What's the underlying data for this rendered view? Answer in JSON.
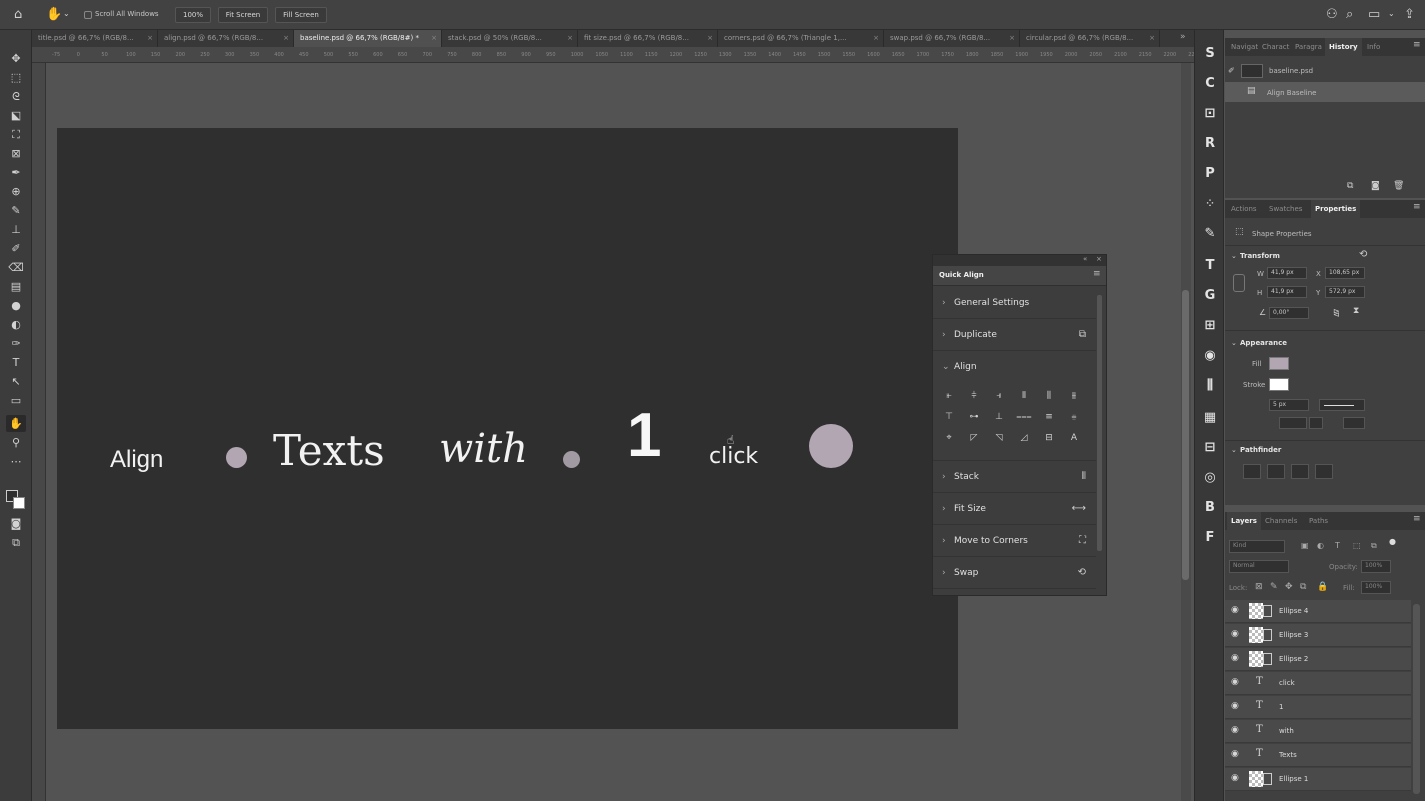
{
  "options_bar": {
    "scroll_all_windows": "Scroll All Windows",
    "zoom": "100%",
    "fit_screen": "Fit Screen",
    "fill_screen": "Fill Screen"
  },
  "tabs": [
    {
      "label": "title.psd @ 66,7% (RGB/8..."
    },
    {
      "label": "align.psd @ 66,7% (RGB/8..."
    },
    {
      "label": "baseline.psd @ 66,7% (RGB/8#) *"
    },
    {
      "label": "stack.psd @ 50% (RGB/8..."
    },
    {
      "label": "fit size.psd @ 66,7% (RGB/8..."
    },
    {
      "label": "corners.psd @ 66,7% (Triangle 1,..."
    },
    {
      "label": "swap.psd @ 66,7% (RGB/8..."
    },
    {
      "label": "circular.psd @ 66,7% (RGB/8..."
    }
  ],
  "ruler_ticks": [
    "-75",
    "0",
    "50",
    "100",
    "150",
    "200",
    "250",
    "300",
    "350",
    "400",
    "450",
    "500",
    "550",
    "600",
    "650",
    "700",
    "750",
    "800",
    "850",
    "900",
    "950",
    "1000",
    "1050",
    "1100",
    "1150",
    "1200",
    "1250",
    "1300",
    "1350",
    "1400",
    "1450",
    "1500",
    "1550",
    "1600",
    "1650",
    "1700",
    "1750",
    "1800",
    "1850",
    "1900",
    "1950",
    "2000",
    "2050",
    "2100",
    "2150",
    "2200",
    "2250",
    "2300"
  ],
  "canvas": {
    "word_align": "Align",
    "word_texts": "Texts",
    "word_with": "with",
    "word_one": "1",
    "word_click": "click"
  },
  "quick_align": {
    "title": "Quick Align",
    "sections": [
      {
        "label": "General Settings"
      },
      {
        "label": "Duplicate"
      },
      {
        "label": "Align"
      },
      {
        "label": "Stack"
      },
      {
        "label": "Fit Size"
      },
      {
        "label": "Move to Corners"
      },
      {
        "label": "Swap"
      }
    ]
  },
  "history_panel": {
    "tabs": [
      "Navigat",
      "Charact",
      "Paragra",
      "History",
      "Info"
    ],
    "active_tab": "History",
    "snapshot": "baseline.psd",
    "step": "Align Baseline"
  },
  "properties_panel": {
    "tabs": [
      "Actions",
      "Swatches",
      "Properties"
    ],
    "active_tab": "Properties",
    "kind": "Shape Properties",
    "transform_label": "Transform",
    "w_label": "W",
    "w": "41,9 px",
    "h_label": "H",
    "h": "41,9 px",
    "x_label": "X",
    "x": "108,65 px",
    "y_label": "Y",
    "y": "572,9 px",
    "angle": "0,00°",
    "appearance_label": "Appearance",
    "fill_label": "Fill",
    "stroke_label": "Stroke",
    "stroke_width": "5 px",
    "pathfinder_label": "Pathfinder",
    "fill_color": "#b3a6b3"
  },
  "layers_panel": {
    "tabs": [
      "Layers",
      "Channels",
      "Paths"
    ],
    "active_tab": "Layers",
    "search_placeholder": "Kind",
    "blend_mode": "Normal",
    "opacity_label": "Opacity:",
    "opacity": "100%",
    "lock_label": "Lock:",
    "fill_label": "Fill:",
    "fill": "100%",
    "layers": [
      {
        "name": "Ellipse 4",
        "type": "shape"
      },
      {
        "name": "Ellipse 3",
        "type": "shape"
      },
      {
        "name": "Ellipse 2",
        "type": "shape"
      },
      {
        "name": "click",
        "type": "text"
      },
      {
        "name": "1",
        "type": "text"
      },
      {
        "name": "with",
        "type": "text"
      },
      {
        "name": "Texts",
        "type": "text"
      },
      {
        "name": "Ellipse 1",
        "type": "shape"
      }
    ]
  },
  "colors": {
    "canvas": "#2f2f2f",
    "dot": "#b3a6b3",
    "workspace": "#535353"
  }
}
